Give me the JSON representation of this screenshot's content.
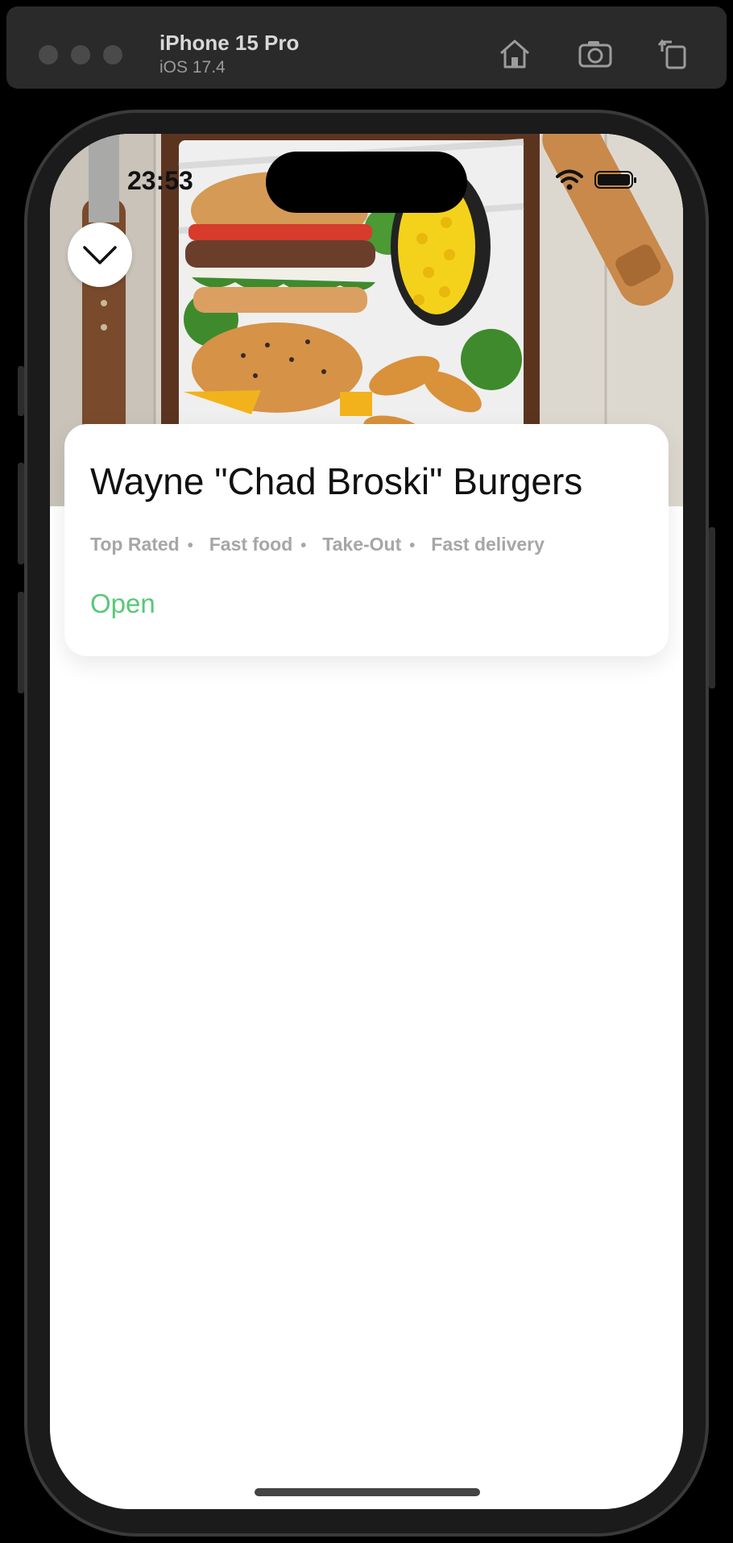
{
  "simulator": {
    "device_name": "iPhone 15 Pro",
    "os_version": "iOS 17.4",
    "toolbar_icons": [
      "home-icon",
      "screenshot-icon",
      "rotate-icon"
    ]
  },
  "status_bar": {
    "time": "23:53",
    "icons": [
      "wifi-icon",
      "battery-icon"
    ]
  },
  "hero": {
    "image_subject": "burgers-and-fries-tray"
  },
  "restaurant": {
    "name": "Wayne \"Chad Broski\" Burgers",
    "tags": [
      "Top Rated",
      "Fast food",
      "Take-Out",
      "Fast delivery"
    ],
    "separator": "•",
    "status": "Open",
    "status_color": "#58c878"
  }
}
